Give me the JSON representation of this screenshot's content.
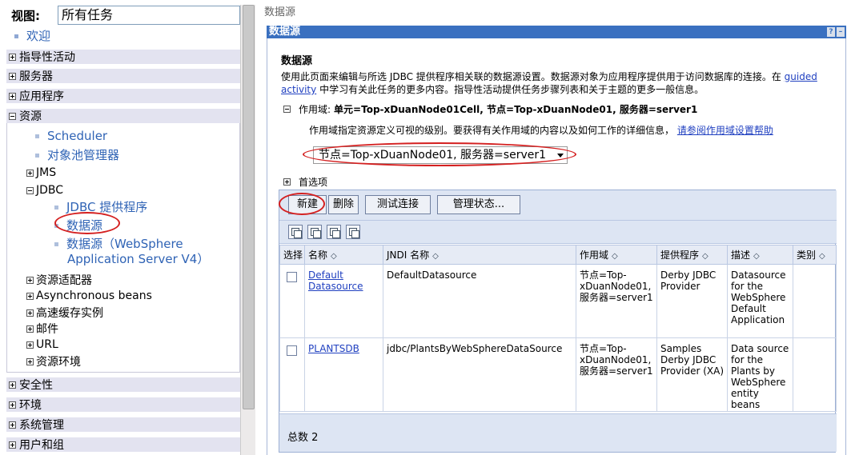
{
  "nav": {
    "view_label": "视图:",
    "view_value": "所有任务",
    "welcome": "欢迎",
    "categories": {
      "guided": "指导性活动",
      "servers": "服务器",
      "apps": "应用程序",
      "resources": "资源",
      "security": "安全性",
      "environment": "环境",
      "sysadmin": "系统管理",
      "users": "用户和组"
    },
    "resources": {
      "scheduler": "Scheduler",
      "objpool": "对象池管理器",
      "jms": "JMS",
      "jdbc": "JDBC",
      "jdbc_provider": "JDBC 提供程序",
      "datasource": "数据源",
      "datasource_v4_line1": "数据源（WebSphere",
      "datasource_v4_line2": "Application Server V4）",
      "adapters": "资源适配器",
      "async": "Asynchronous beans",
      "cache": "高速缓存实例",
      "mail": "邮件",
      "url": "URL",
      "resenv": "资源环境"
    }
  },
  "main": {
    "breadcrumb": "数据源",
    "titlebar": "数据源",
    "help_btn": "?",
    "min_btn": "–",
    "heading": "数据源",
    "desc_text": "使用此页面来编辑与所选 JDBC 提供程序相关联的数据源设置。数据源对象为应用程序提供用于访问数据库的连接。在",
    "desc_link_1": "guided",
    "desc_link_2": "activity",
    "desc_tail": "中学习有关此任务的更多内容。指导性活动提供任务步骤列表和关于主题的更多一般信息。",
    "scope_label": "作用域:",
    "scope_value": "单元=Top-xDuanNode01Cell, 节点=Top-xDuanNode01, 服务器=server1",
    "scope_help": "作用域指定资源定义可视的级别。要获得有关作用域的内容以及如何工作的详细信息，",
    "scope_help_link": "请参阅作用域设置帮助",
    "scope_select": "节点=Top-xDuanNode01, 服务器=server1",
    "preferences": "首选项",
    "buttons": {
      "new": "新建",
      "delete": "删除",
      "test": "测试连接",
      "manage": "管理状态..."
    },
    "columns": {
      "select": "选择",
      "name": "名称",
      "jndi": "JNDI 名称",
      "scope": "作用域",
      "provider": "提供程序",
      "desc": "描述",
      "category": "类别"
    },
    "rows": [
      {
        "name": "Default Datasource",
        "jndi": "DefaultDatasource",
        "scope": "节点=Top-xDuanNode01, 服务器=server1",
        "provider": "Derby JDBC Provider",
        "desc": "Datasource for the WebSphere Default Application",
        "category": ""
      },
      {
        "name": "PLANTSDB",
        "jndi": "jdbc/PlantsByWebSphereDataSource",
        "scope": "节点=Top-xDuanNode01, 服务器=server1",
        "provider": "Samples Derby JDBC Provider (XA)",
        "desc": "Data source for the Plants by WebSphere entity beans",
        "category": ""
      }
    ],
    "total": "总数 2",
    "sort_glyph": "◇"
  },
  "colors": {
    "titlebar": "#3a70c0",
    "link": "#2040c0",
    "nav_link": "#2f63b5",
    "annotation": "#d42020"
  }
}
